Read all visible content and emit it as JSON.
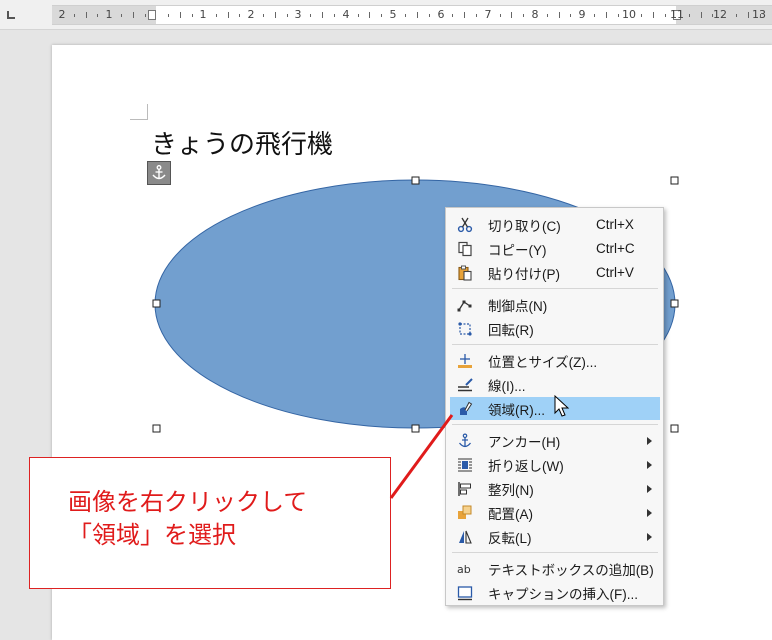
{
  "ruler": {
    "labels": [
      "2",
      "1",
      "1",
      "2",
      "3",
      "4",
      "5",
      "6",
      "7",
      "8",
      "9",
      "10",
      "11",
      "12",
      "13"
    ]
  },
  "document": {
    "heading": "きょうの飛行機",
    "shape_fill": "#729fcf",
    "shape_stroke": "#3465a4"
  },
  "context_menu": {
    "items": [
      {
        "label": "切り取り(C)",
        "shortcut": "Ctrl+X",
        "icon": "scissors-icon"
      },
      {
        "label": "コピー(Y)",
        "shortcut": "Ctrl+C",
        "icon": "copy-icon"
      },
      {
        "label": "貼り付け(P)",
        "shortcut": "Ctrl+V",
        "icon": "paste-icon"
      },
      {
        "label": "制御点(N)",
        "shortcut": "",
        "icon": "points-icon"
      },
      {
        "label": "回転(R)",
        "shortcut": "",
        "icon": "rotate-icon"
      },
      {
        "label": "位置とサイズ(Z)...",
        "shortcut": "",
        "icon": "position-size-icon"
      },
      {
        "label": "線(I)...",
        "shortcut": "",
        "icon": "line-icon"
      },
      {
        "label": "領域(R)...",
        "shortcut": "",
        "icon": "area-icon"
      },
      {
        "label": "アンカー(H)",
        "shortcut": "",
        "icon": "anchor-icon"
      },
      {
        "label": "折り返し(W)",
        "shortcut": "",
        "icon": "wrap-icon"
      },
      {
        "label": "整列(N)",
        "shortcut": "",
        "icon": "align-icon"
      },
      {
        "label": "配置(A)",
        "shortcut": "",
        "icon": "arrange-icon"
      },
      {
        "label": "反転(L)",
        "shortcut": "",
        "icon": "flip-icon"
      },
      {
        "label": "テキストボックスの追加(B)",
        "shortcut": "",
        "icon": "textbox-icon"
      },
      {
        "label": "キャプションの挿入(F)...",
        "shortcut": "",
        "icon": "caption-icon"
      }
    ],
    "highlight_color": "#9fd1f7"
  },
  "callout": {
    "line1": "画像を右クリックして",
    "line2": "「領域」を選択",
    "color": "#e01b1b"
  }
}
